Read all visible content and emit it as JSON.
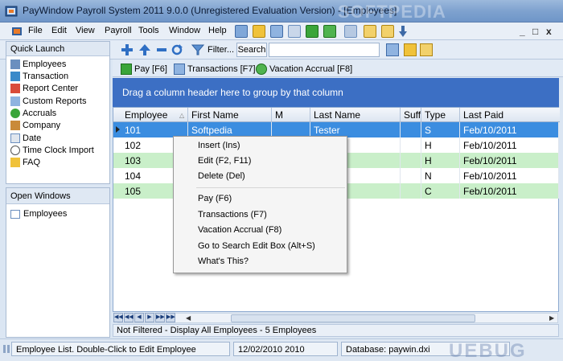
{
  "window": {
    "title": "PayWindow Payroll System 2011  9.0.0 (Unregistered Evaluation Version) - [Employees]",
    "watermark": "SOFTPEDIA"
  },
  "menubar": {
    "items": [
      "File",
      "Edit",
      "View",
      "Payroll",
      "Tools",
      "Window",
      "Help"
    ],
    "controls": [
      "_",
      "□",
      "x"
    ]
  },
  "toolbar2": {
    "filter_label": "Filter...",
    "search_label": "Search",
    "search_value": ""
  },
  "quick_launch": {
    "header": "Quick Launch",
    "items": [
      "Employees",
      "Transaction",
      "Report Center",
      "Custom Reports",
      "Accruals",
      "Company",
      "Date",
      "Time Clock Import",
      "FAQ"
    ]
  },
  "open_windows": {
    "header": "Open Windows",
    "items": [
      "Employees"
    ]
  },
  "child_tabs": {
    "pay": "Pay [F6]",
    "transactions": "Transactions [F7]",
    "vacation": "Vacation Accrual [F8]"
  },
  "group_area": "Drag a column header here to group by that column",
  "grid": {
    "columns": [
      "Employee",
      "First Name",
      "M",
      "Last Name",
      "Suff",
      "Type",
      "Last Paid"
    ],
    "rows": [
      [
        "101",
        "Softpedia",
        "",
        "Tester",
        "",
        "S",
        "Feb/10/2011"
      ],
      [
        "102",
        "",
        "",
        "",
        "",
        "H",
        "Feb/10/2011"
      ],
      [
        "103",
        "",
        "",
        "",
        "",
        "H",
        "Feb/10/2011"
      ],
      [
        "104",
        "",
        "",
        "",
        "",
        "N",
        "Feb/10/2011"
      ],
      [
        "105",
        "",
        "",
        "",
        "",
        "C",
        "Feb/10/2011"
      ]
    ]
  },
  "info_bar": "Not Filtered - Display All Employees  - 5 Employees",
  "status_bar": {
    "hint": "Employee List. Double-Click to Edit Employee",
    "date": "12/02/2010 2010",
    "database": "Database: paywin.dxi",
    "watermark": "UEBUG"
  },
  "context_menu": {
    "items": [
      "Insert (Ins)",
      "Edit (F2, F11)",
      "Delete (Del)",
      "Pay (F6)",
      "Transactions (F7)",
      "Vacation Accrual (F8)",
      "Go to Search Edit Box (Alt+S)",
      "What's This?"
    ]
  },
  "colors": {
    "selected_row": "#3b8de0",
    "green_row": "#c9efc9",
    "group_area": "#3c6fc4"
  }
}
